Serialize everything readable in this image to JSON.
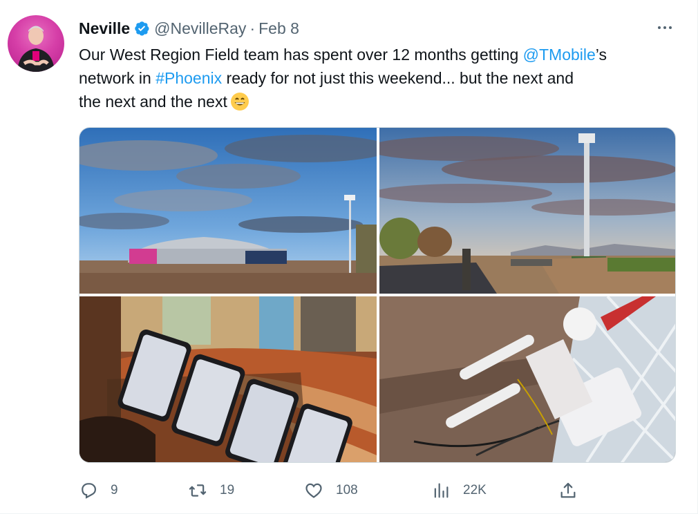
{
  "author": {
    "name": "Neville",
    "handle": "@NevilleRay",
    "separator": "·",
    "date": "Feb 8",
    "verified": true,
    "avatar_icon": "profile-photo"
  },
  "tweet": {
    "line1_a": "Our West Region Field team has spent over 12 months getting ",
    "mention": "@TMobile",
    "line1_b": "’s",
    "line2_a": "network in ",
    "hashtag": "#Phoenix",
    "line2_b": " ready for not just this weekend... but the next and",
    "line3": "the next and the next",
    "emoji": "grinning-face-emoji"
  },
  "media": {
    "photos": [
      {
        "icon": "stadium-photo"
      },
      {
        "icon": "cell-tower-road-photo"
      },
      {
        "icon": "phones-testing-photo"
      },
      {
        "icon": "antenna-equipment-photo"
      }
    ]
  },
  "actions": {
    "replies": "9",
    "retweets": "19",
    "likes": "108",
    "views": "22K"
  },
  "colors": {
    "link": "#1d9bf0",
    "verified": "#1d9bf0",
    "secondary_text": "#536471",
    "primary_text": "#0f1419",
    "avatar_bg": "#d63fa8"
  }
}
